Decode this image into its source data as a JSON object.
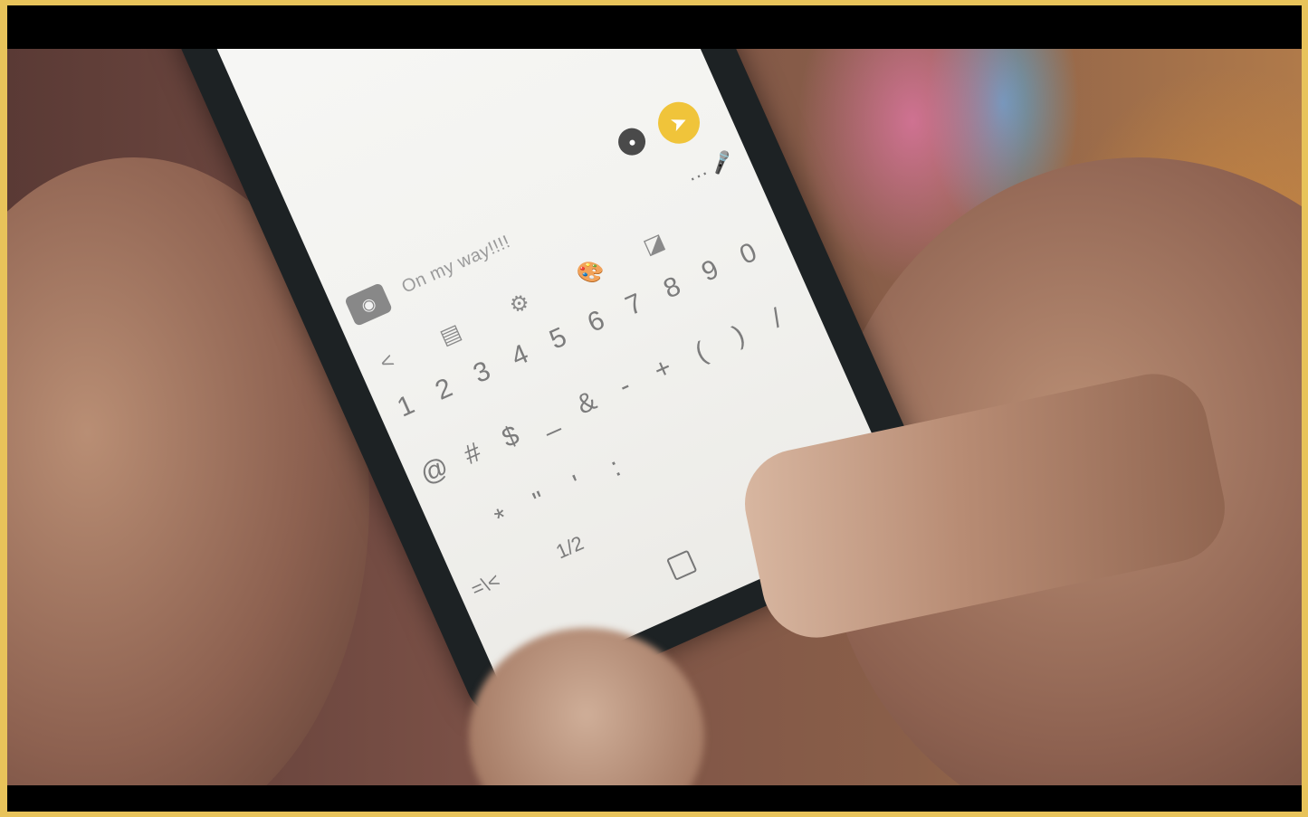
{
  "message": {
    "text": "On my way!!!!"
  },
  "top_icons": [
    "chat-icon",
    "send-icon",
    "mic-icon"
  ],
  "toolbar": {
    "icons": [
      "camera-icon",
      "back-icon",
      "clipboard-icon",
      "settings-icon",
      "palette-icon",
      "resize-icon",
      "more-icon"
    ],
    "back": "<",
    "more": "···"
  },
  "keyboard": {
    "numbers": [
      "1",
      "2",
      "3",
      "4",
      "5",
      "6",
      "7",
      "8",
      "9",
      "0"
    ],
    "symbols_row1": [
      "@",
      "#",
      "$",
      "_",
      "&",
      "-",
      "+",
      "(",
      ")",
      "/"
    ],
    "symbols_row2": [
      "*",
      "\"",
      "'",
      ":"
    ],
    "switch_key": "=\\<",
    "page_key": "1/2"
  },
  "colors": {
    "send_button": "#f0c43a",
    "screen": "#f2f2ef",
    "frame_border": "#e8c35a"
  }
}
